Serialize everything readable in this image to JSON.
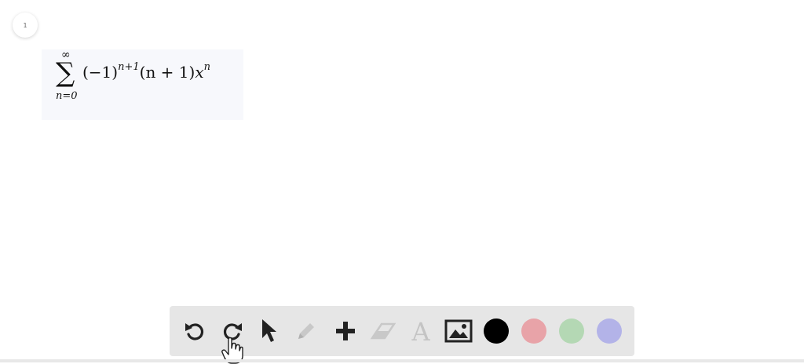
{
  "page_badge": {
    "number": "1"
  },
  "formula": {
    "sum_upper": "∞",
    "sum_lower": "n=0",
    "base1": "(−1)",
    "exp1": "n+1",
    "middle": "(n + 1)",
    "var": "x",
    "exp2": "n"
  },
  "toolbar": {
    "tools": [
      "undo-icon",
      "redo-icon",
      "select-icon",
      "pen-icon",
      "add-icon",
      "eraser-icon",
      "text-icon",
      "image-icon"
    ],
    "colors": [
      "#000000",
      "#e8a3a8",
      "#b4d8b4",
      "#b3b3e8"
    ]
  }
}
